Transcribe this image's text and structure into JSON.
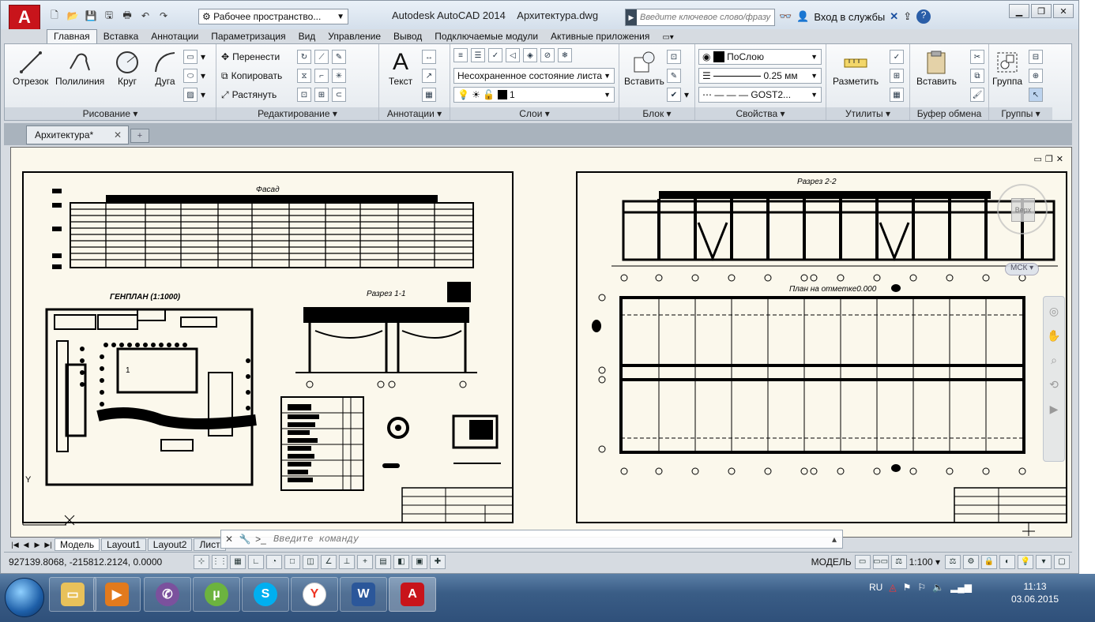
{
  "app": {
    "title": "Autodesk AutoCAD 2014",
    "file": "Архитектура.dwg",
    "logo": "A",
    "workspace": "Рабочее пространство...",
    "search_placeholder": "Введите ключевое слово/фразу",
    "signin": "Вход в службы"
  },
  "ribbon_tabs": [
    "Главная",
    "Вставка",
    "Аннотации",
    "Параметризация",
    "Вид",
    "Управление",
    "Вывод",
    "Подключаемые модули",
    "Активные приложения"
  ],
  "ribbon": {
    "draw": {
      "title": "Рисование ▾",
      "line": "Отрезок",
      "polyline": "Полилиния",
      "circle": "Круг",
      "arc": "Дуга"
    },
    "modify": {
      "title": "Редактирование ▾",
      "move": "Перенести",
      "copy": "Копировать",
      "stretch": "Растянуть"
    },
    "annotation": {
      "title": "Аннотации ▾",
      "text": "Текст"
    },
    "layers": {
      "title": "Слои ▾",
      "state": "Несохраненное состояние листа",
      "current": "1"
    },
    "block": {
      "title": "Блок ▾",
      "insert": "Вставить"
    },
    "properties": {
      "title": "Свойства ▾",
      "color": "ПоСлою",
      "lineweight": "0.25 мм",
      "linetype": "GOST2..."
    },
    "utilities": {
      "title": "Утилиты ▾",
      "measure": "Разметить"
    },
    "clipboard": {
      "title": "Буфер обмена",
      "paste": "Вставить"
    },
    "groups": {
      "title": "Группы ▾",
      "group": "Группа"
    }
  },
  "doc_tab": {
    "name": "Архитектура*"
  },
  "drawing": {
    "facade_title": "Фасад",
    "genplan_title": "ГЕНПЛАН (1:1000)",
    "section11": "Разрез 1-1",
    "section22": "Разрез 2-2",
    "plan_title": "План на отметке0.000",
    "vcube_top": "Верх",
    "ucs": "МСК"
  },
  "layout_tabs": [
    "Модель",
    "Layout1",
    "Layout2",
    "Лист"
  ],
  "command_placeholder": "Введите команду",
  "status": {
    "coords": "927139.8068, -215812.2124, 0.0000",
    "model": "МОДЕЛЬ",
    "scale": "1:100"
  },
  "taskbar": {
    "lang": "RU",
    "time": "11:13",
    "date": "03.06.2015"
  },
  "colors": {
    "accent": "#c8141b",
    "paper": "#fbf8ec",
    "ribbon_bg": "#e4e9ee"
  }
}
